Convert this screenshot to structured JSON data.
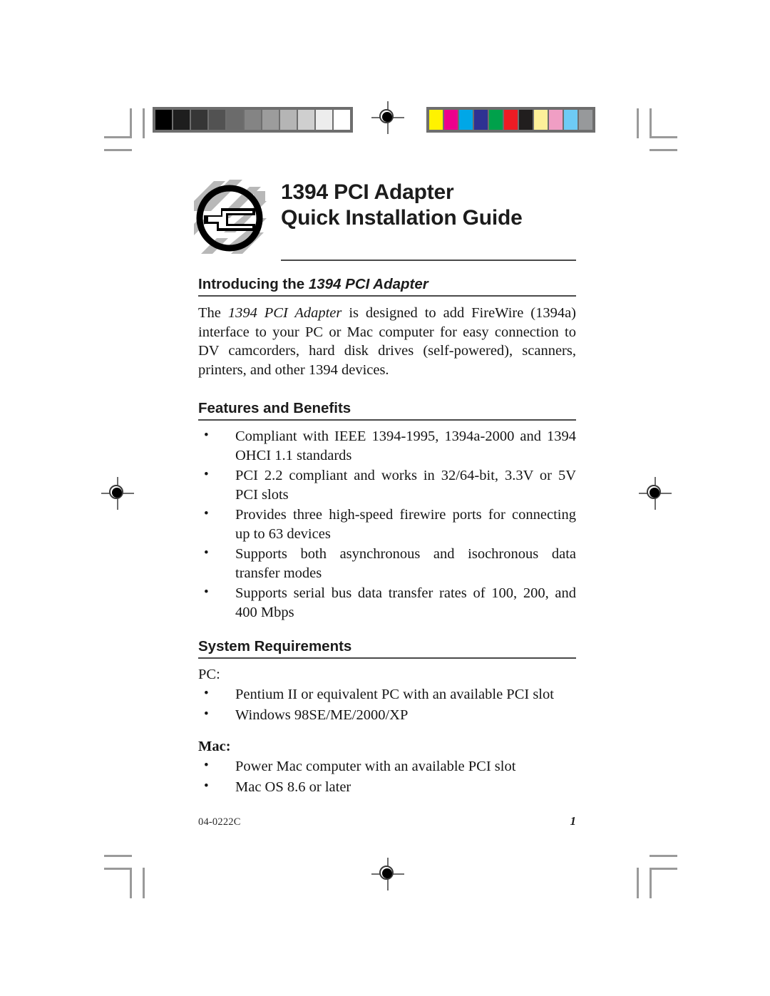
{
  "document": {
    "title_lines": [
      "1394 PCI Adapter",
      "Quick Installation Guide"
    ],
    "logo_name": "siig-circle-logo"
  },
  "sections": {
    "introducing": {
      "heading_prefix": "Introducing the ",
      "heading_italic": "1394 PCI Adapter",
      "paragraph_parts": {
        "lead": "The ",
        "product_italic": "1394 PCI Adapter",
        "rest": " is designed to add FireWire (1394a) interface to your PC or Mac computer for easy connection to DV camcorders, hard disk drives (self-powered), scanners, printers, and other 1394 devices."
      }
    },
    "features": {
      "heading": "Features and Benefits",
      "items": [
        "Compliant with IEEE 1394-1995, 1394a-2000 and 1394 OHCI 1.1 standards",
        "PCI 2.2 compliant and works in 32/64-bit, 3.3V or 5V PCI slots",
        "Provides three high-speed firewire ports for connecting up to 63 devices",
        "Supports both asynchronous and isochronous data transfer modes",
        "Supports serial bus data transfer rates of 100, 200, and 400 Mbps"
      ]
    },
    "requirements": {
      "heading": "System Requirements",
      "pc_label": "PC:",
      "pc_items": [
        "Pentium II or equivalent PC with an available PCI slot",
        "Windows 98SE/ME/2000/XP"
      ],
      "mac_label": "Mac:",
      "mac_items": [
        "Power Mac computer with an available PCI slot",
        "Mac OS 8.6 or later"
      ]
    }
  },
  "footer": {
    "doc_id": "04-0222C",
    "page_number": "1"
  },
  "print_marks": {
    "grayscale_swatches": [
      "#000000",
      "#1e1e1e",
      "#363636",
      "#525252",
      "#6b6b6b",
      "#848484",
      "#9c9c9c",
      "#b5b5b5",
      "#cfcfcf",
      "#ededed",
      "#ffffff"
    ],
    "color_swatches": [
      "#fff200",
      "#ec008c",
      "#00a7e7",
      "#2e3192",
      "#00a14b",
      "#ed1c24",
      "#211e1e",
      "#fdf09a",
      "#f09ec4",
      "#6ecbf5",
      "#97999b"
    ],
    "registration_mark_name": "registration-target",
    "crop_mark_name": "corner-crop-mark"
  }
}
